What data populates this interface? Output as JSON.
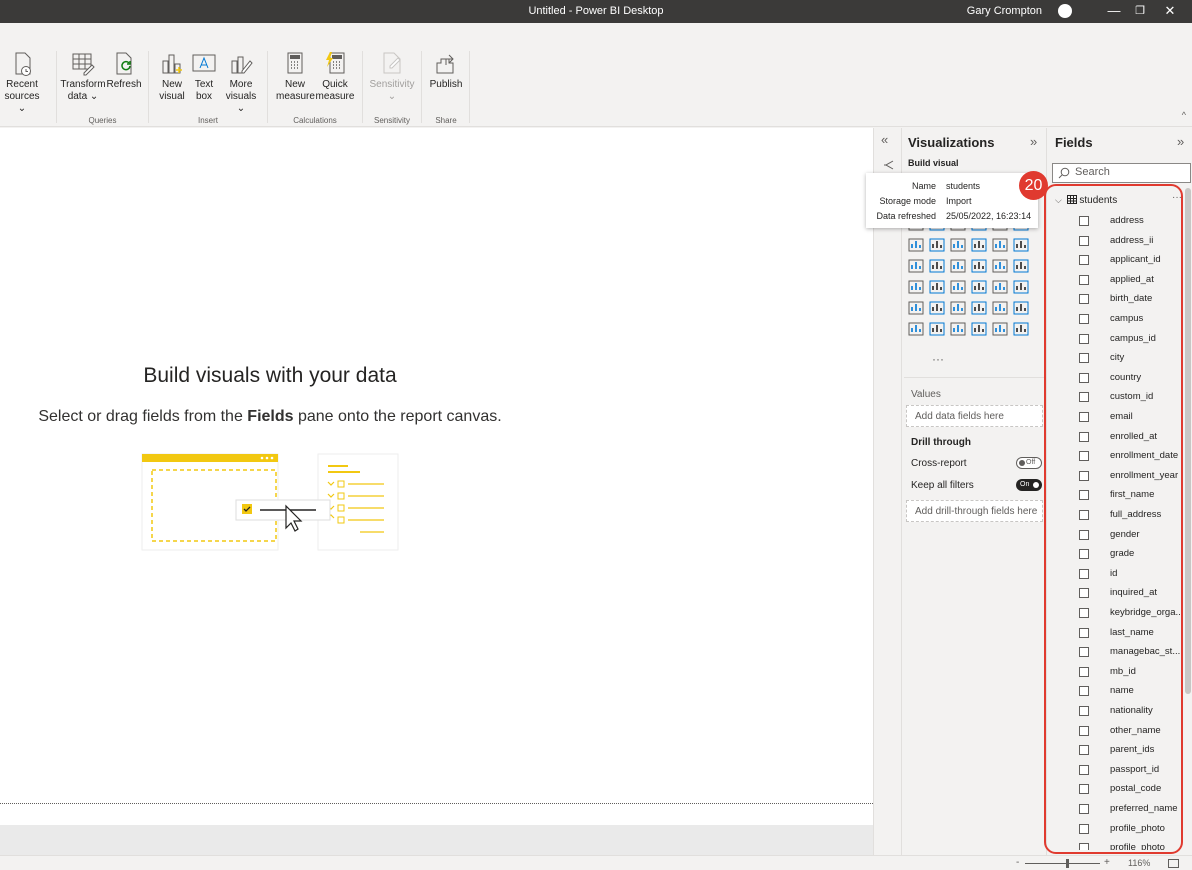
{
  "window": {
    "title": "Untitled - Power BI Desktop",
    "user": "Gary Crompton",
    "minimize": "—",
    "restore": "❐",
    "close": "✕"
  },
  "ribbon": {
    "buttons": {
      "recent_sources": [
        "Recent",
        "sources ⌄"
      ],
      "transform_data": [
        "Transform",
        "data ⌄"
      ],
      "refresh": [
        "Refresh"
      ],
      "new_visual": [
        "New",
        "visual"
      ],
      "text_box": [
        "Text",
        "box"
      ],
      "more_visuals": [
        "More",
        "visuals ⌄"
      ],
      "new_measure": [
        "New",
        "measure"
      ],
      "quick_measure": [
        "Quick",
        "measure"
      ],
      "sensitivity": [
        "Sensitivity",
        "⌄"
      ],
      "publish": [
        "Publish"
      ]
    },
    "groups": {
      "queries": "Queries",
      "insert": "Insert",
      "calculations": "Calculations",
      "sensitivity": "Sensitivity",
      "share": "Share"
    },
    "collapse": "^"
  },
  "canvas": {
    "empty_title": "Build visuals with your data",
    "empty_sub_pre": "Select or drag fields from the ",
    "empty_sub_bold": "Fields",
    "empty_sub_post": " pane onto the report canvas."
  },
  "visualizations": {
    "collapse_all": "«",
    "title": "Visualizations",
    "expand": "»",
    "build_visual_icon": "build-visual-icon",
    "build_visual": "Build visual",
    "more_dots": "···",
    "values_label": "Values",
    "values_placeholder": "Add data fields here",
    "drill_through": "Drill through",
    "cross_report": "Cross-report",
    "cross_report_state": "Off",
    "keep_all_filters": "Keep all filters",
    "keep_all_filters_state": "On",
    "drill_placeholder": "Add drill-through fields here"
  },
  "tooltip": {
    "name_label": "Name",
    "name_value": "students",
    "storage_label": "Storage mode",
    "storage_value": "Import",
    "refreshed_label": "Data refreshed",
    "refreshed_value": "25/05/2022, 16:23:14"
  },
  "step_badge": "20",
  "fields": {
    "title": "Fields",
    "expand": "»",
    "search_placeholder": "Search",
    "table_name": "students",
    "table_more": "···",
    "items": [
      "address",
      "address_ii",
      "applicant_id",
      "applied_at",
      "birth_date",
      "campus",
      "campus_id",
      "city",
      "country",
      "custom_id",
      "email",
      "enrolled_at",
      "enrollment_date",
      "enrollment_year",
      "first_name",
      "full_address",
      "gender",
      "grade",
      "id",
      "inquired_at",
      "keybridge_orga...",
      "last_name",
      "managebac_st...",
      "mb_id",
      "name",
      "nationality",
      "other_name",
      "parent_ids",
      "passport_id",
      "postal_code",
      "preferred_name",
      "profile_photo",
      "profile_photo"
    ]
  },
  "status": {
    "zoom_minus": "-",
    "zoom_plus": "+",
    "zoom": "116%"
  },
  "colors": {
    "accent_yellow": "#f2c811",
    "highlight_red": "#e03a2f",
    "title_bar": "#3b3a39"
  }
}
